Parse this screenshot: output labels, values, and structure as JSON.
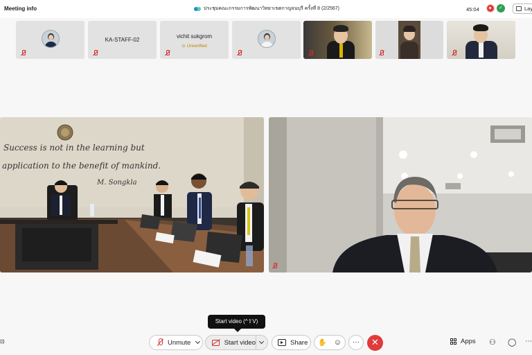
{
  "topbar": {
    "meeting_info_label": "Meeting info",
    "meeting_title": "ประชุมคณะกรรมการพัฒนาวิทยาเขตกาญจนบุรี ครั้งที่ 8 (2/2567)",
    "timer": "45:04",
    "layout_label": "Lay"
  },
  "participants": [
    {
      "name": "",
      "kind": "avatar",
      "muted": true
    },
    {
      "name": "KA-STAFF-02",
      "kind": "name",
      "muted": true
    },
    {
      "name": "vichit sukgrom",
      "status": "Unverified",
      "kind": "name",
      "muted": true
    },
    {
      "name": "",
      "kind": "avatar-light",
      "muted": true
    },
    {
      "name": "",
      "kind": "video",
      "muted": true
    },
    {
      "name": "",
      "kind": "video",
      "muted": true
    },
    {
      "name": "",
      "kind": "video",
      "muted": true
    }
  ],
  "main_left": {
    "wall_quote_line1": "Success is not in the learning but",
    "wall_quote_line2": "application to the benefit of mankind.",
    "wall_quote_signature": "M. Songkla"
  },
  "tooltip": "Start video (^⇧V)",
  "toolbar": {
    "unmute_label": "Unmute",
    "start_video_label": "Start video",
    "share_label": "Share",
    "more_glyph": "···",
    "end_glyph": "✕",
    "apps_label": "Apps"
  },
  "colors": {
    "end_red": "#e03b3b",
    "mute_red": "#d12c2c",
    "unverified_amber": "#b98600",
    "tooltip_bg": "#111111"
  }
}
